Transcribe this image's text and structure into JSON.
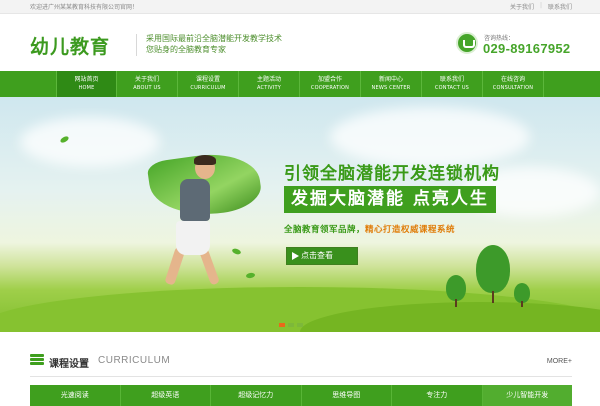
{
  "topbar": {
    "welcome": "欢迎进广州某某教育科技有限公司官网！",
    "links": [
      "关于我们",
      "联系我们"
    ]
  },
  "header": {
    "logo": "幼儿教育",
    "slogan_line1": "采用国际最前沿全脑潜能开发教学技术",
    "slogan_line2": "您贴身的全脑教育专家",
    "phone_label": "咨询热线：",
    "phone_number": "029-89167952"
  },
  "nav": {
    "items": [
      {
        "cn": "网站首页",
        "en": "HOME"
      },
      {
        "cn": "关于我们",
        "en": "ABOUT US"
      },
      {
        "cn": "课程设置",
        "en": "CURRICULUM"
      },
      {
        "cn": "主题活动",
        "en": "ACTIVITY"
      },
      {
        "cn": "加盟合作",
        "en": "COOPERATION"
      },
      {
        "cn": "新闻中心",
        "en": "NEWS CENTER"
      },
      {
        "cn": "联系我们",
        "en": "CONTACT US"
      },
      {
        "cn": "在线咨询",
        "en": "CONSULTATION"
      }
    ]
  },
  "banner": {
    "headline": "引领全脑潜能开发连锁机构",
    "headline_box": "发掘大脑潜能 点亮人生",
    "subline_a": "全脑教育领军品牌，",
    "subline_b": "精心打造权威课程系统",
    "cta": "点击查看",
    "slides": 3,
    "active_slide": 1
  },
  "section": {
    "title": "课程设置",
    "title_en": "CURRICULUM",
    "more": "MORE+",
    "tabs": [
      "光速阅读",
      "超级英语",
      "超级记忆力",
      "思维导图",
      "专注力",
      "少儿智能开发"
    ]
  },
  "colors": {
    "brand_green": "#3f9f1e",
    "accent_orange": "#e86a1a"
  }
}
